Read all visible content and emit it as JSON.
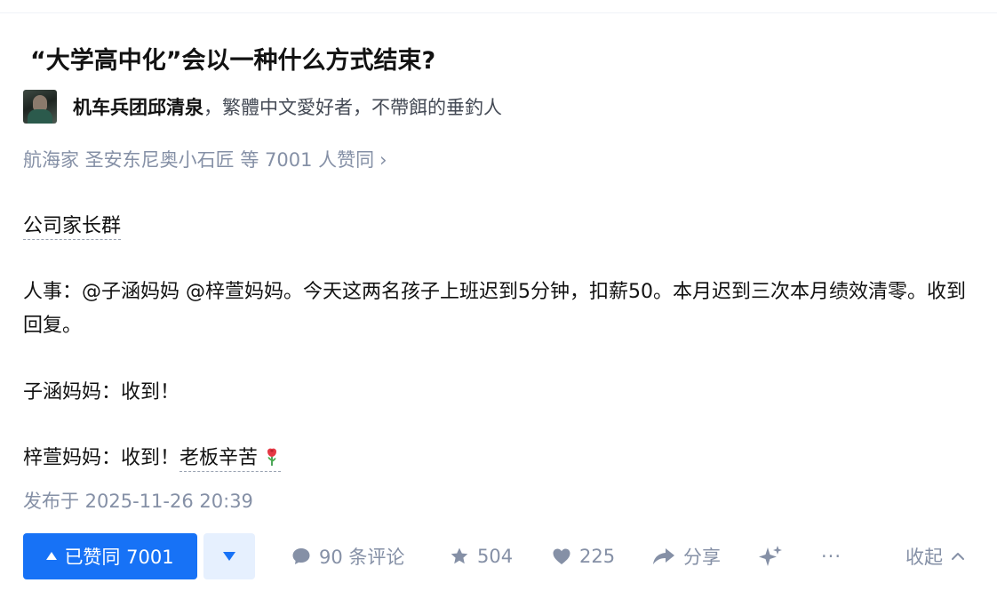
{
  "question": {
    "title": "“大学高中化”会以一种什么方式结束?"
  },
  "author": {
    "name": "机车兵团邱清泉",
    "bio": "，繁體中文愛好者，不帶餌的垂釣人"
  },
  "voters": {
    "text": "航海家 圣安东尼奥小石匠 等 7001 人赞同",
    "chevron": "›"
  },
  "content": {
    "p1": "公司家长群",
    "p2": "人事：@子涵妈妈 @梓萱妈妈。今天这两名孩子上班迟到5分钟，扣薪50。本月迟到三次本月绩效清零。收到回复。",
    "p3": "子涵妈妈：收到！",
    "p4_prefix": "梓萱妈妈：收到！",
    "p4_link": "老板辛苦"
  },
  "published": "发布于 2025-11-26 20:39",
  "actions": {
    "upvote_label": "已赞同 7001",
    "comments_label": "90 条评论",
    "favorites_count": "504",
    "likes_count": "225",
    "share_label": "分享",
    "more_label": "···",
    "collapse_label": "收起"
  },
  "colors": {
    "primary_blue": "#1772f6",
    "light_blue_bg": "#e6f0fe",
    "muted_gray": "#8590a6",
    "text_dark": "#121212"
  },
  "icons": {
    "avatar": "avatar-image",
    "rose": "rose-icon",
    "comment": "comment-bubble-icon",
    "star": "star-icon",
    "heart": "heart-icon",
    "share": "share-arrow-icon",
    "sparkle": "sparkle-icon",
    "collapse": "chevron-up-icon"
  }
}
